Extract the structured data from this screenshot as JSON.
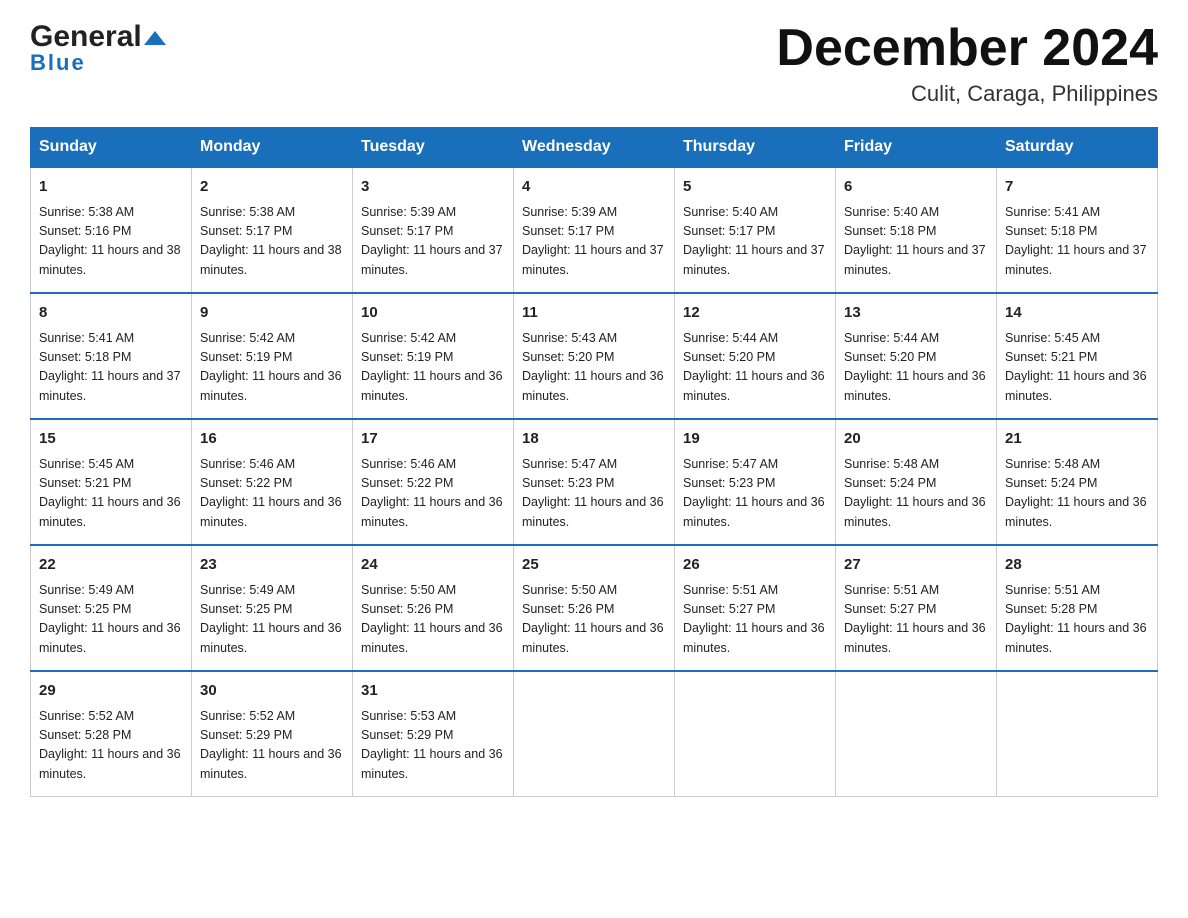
{
  "header": {
    "logo_general": "General",
    "logo_blue": "Blue",
    "month_title": "December 2024",
    "location": "Culit, Caraga, Philippines"
  },
  "days_of_week": [
    "Sunday",
    "Monday",
    "Tuesday",
    "Wednesday",
    "Thursday",
    "Friday",
    "Saturday"
  ],
  "weeks": [
    [
      {
        "day": "1",
        "sunrise": "Sunrise: 5:38 AM",
        "sunset": "Sunset: 5:16 PM",
        "daylight": "Daylight: 11 hours and 38 minutes."
      },
      {
        "day": "2",
        "sunrise": "Sunrise: 5:38 AM",
        "sunset": "Sunset: 5:17 PM",
        "daylight": "Daylight: 11 hours and 38 minutes."
      },
      {
        "day": "3",
        "sunrise": "Sunrise: 5:39 AM",
        "sunset": "Sunset: 5:17 PM",
        "daylight": "Daylight: 11 hours and 37 minutes."
      },
      {
        "day": "4",
        "sunrise": "Sunrise: 5:39 AM",
        "sunset": "Sunset: 5:17 PM",
        "daylight": "Daylight: 11 hours and 37 minutes."
      },
      {
        "day": "5",
        "sunrise": "Sunrise: 5:40 AM",
        "sunset": "Sunset: 5:17 PM",
        "daylight": "Daylight: 11 hours and 37 minutes."
      },
      {
        "day": "6",
        "sunrise": "Sunrise: 5:40 AM",
        "sunset": "Sunset: 5:18 PM",
        "daylight": "Daylight: 11 hours and 37 minutes."
      },
      {
        "day": "7",
        "sunrise": "Sunrise: 5:41 AM",
        "sunset": "Sunset: 5:18 PM",
        "daylight": "Daylight: 11 hours and 37 minutes."
      }
    ],
    [
      {
        "day": "8",
        "sunrise": "Sunrise: 5:41 AM",
        "sunset": "Sunset: 5:18 PM",
        "daylight": "Daylight: 11 hours and 37 minutes."
      },
      {
        "day": "9",
        "sunrise": "Sunrise: 5:42 AM",
        "sunset": "Sunset: 5:19 PM",
        "daylight": "Daylight: 11 hours and 36 minutes."
      },
      {
        "day": "10",
        "sunrise": "Sunrise: 5:42 AM",
        "sunset": "Sunset: 5:19 PM",
        "daylight": "Daylight: 11 hours and 36 minutes."
      },
      {
        "day": "11",
        "sunrise": "Sunrise: 5:43 AM",
        "sunset": "Sunset: 5:20 PM",
        "daylight": "Daylight: 11 hours and 36 minutes."
      },
      {
        "day": "12",
        "sunrise": "Sunrise: 5:44 AM",
        "sunset": "Sunset: 5:20 PM",
        "daylight": "Daylight: 11 hours and 36 minutes."
      },
      {
        "day": "13",
        "sunrise": "Sunrise: 5:44 AM",
        "sunset": "Sunset: 5:20 PM",
        "daylight": "Daylight: 11 hours and 36 minutes."
      },
      {
        "day": "14",
        "sunrise": "Sunrise: 5:45 AM",
        "sunset": "Sunset: 5:21 PM",
        "daylight": "Daylight: 11 hours and 36 minutes."
      }
    ],
    [
      {
        "day": "15",
        "sunrise": "Sunrise: 5:45 AM",
        "sunset": "Sunset: 5:21 PM",
        "daylight": "Daylight: 11 hours and 36 minutes."
      },
      {
        "day": "16",
        "sunrise": "Sunrise: 5:46 AM",
        "sunset": "Sunset: 5:22 PM",
        "daylight": "Daylight: 11 hours and 36 minutes."
      },
      {
        "day": "17",
        "sunrise": "Sunrise: 5:46 AM",
        "sunset": "Sunset: 5:22 PM",
        "daylight": "Daylight: 11 hours and 36 minutes."
      },
      {
        "day": "18",
        "sunrise": "Sunrise: 5:47 AM",
        "sunset": "Sunset: 5:23 PM",
        "daylight": "Daylight: 11 hours and 36 minutes."
      },
      {
        "day": "19",
        "sunrise": "Sunrise: 5:47 AM",
        "sunset": "Sunset: 5:23 PM",
        "daylight": "Daylight: 11 hours and 36 minutes."
      },
      {
        "day": "20",
        "sunrise": "Sunrise: 5:48 AM",
        "sunset": "Sunset: 5:24 PM",
        "daylight": "Daylight: 11 hours and 36 minutes."
      },
      {
        "day": "21",
        "sunrise": "Sunrise: 5:48 AM",
        "sunset": "Sunset: 5:24 PM",
        "daylight": "Daylight: 11 hours and 36 minutes."
      }
    ],
    [
      {
        "day": "22",
        "sunrise": "Sunrise: 5:49 AM",
        "sunset": "Sunset: 5:25 PM",
        "daylight": "Daylight: 11 hours and 36 minutes."
      },
      {
        "day": "23",
        "sunrise": "Sunrise: 5:49 AM",
        "sunset": "Sunset: 5:25 PM",
        "daylight": "Daylight: 11 hours and 36 minutes."
      },
      {
        "day": "24",
        "sunrise": "Sunrise: 5:50 AM",
        "sunset": "Sunset: 5:26 PM",
        "daylight": "Daylight: 11 hours and 36 minutes."
      },
      {
        "day": "25",
        "sunrise": "Sunrise: 5:50 AM",
        "sunset": "Sunset: 5:26 PM",
        "daylight": "Daylight: 11 hours and 36 minutes."
      },
      {
        "day": "26",
        "sunrise": "Sunrise: 5:51 AM",
        "sunset": "Sunset: 5:27 PM",
        "daylight": "Daylight: 11 hours and 36 minutes."
      },
      {
        "day": "27",
        "sunrise": "Sunrise: 5:51 AM",
        "sunset": "Sunset: 5:27 PM",
        "daylight": "Daylight: 11 hours and 36 minutes."
      },
      {
        "day": "28",
        "sunrise": "Sunrise: 5:51 AM",
        "sunset": "Sunset: 5:28 PM",
        "daylight": "Daylight: 11 hours and 36 minutes."
      }
    ],
    [
      {
        "day": "29",
        "sunrise": "Sunrise: 5:52 AM",
        "sunset": "Sunset: 5:28 PM",
        "daylight": "Daylight: 11 hours and 36 minutes."
      },
      {
        "day": "30",
        "sunrise": "Sunrise: 5:52 AM",
        "sunset": "Sunset: 5:29 PM",
        "daylight": "Daylight: 11 hours and 36 minutes."
      },
      {
        "day": "31",
        "sunrise": "Sunrise: 5:53 AM",
        "sunset": "Sunset: 5:29 PM",
        "daylight": "Daylight: 11 hours and 36 minutes."
      },
      null,
      null,
      null,
      null
    ]
  ]
}
